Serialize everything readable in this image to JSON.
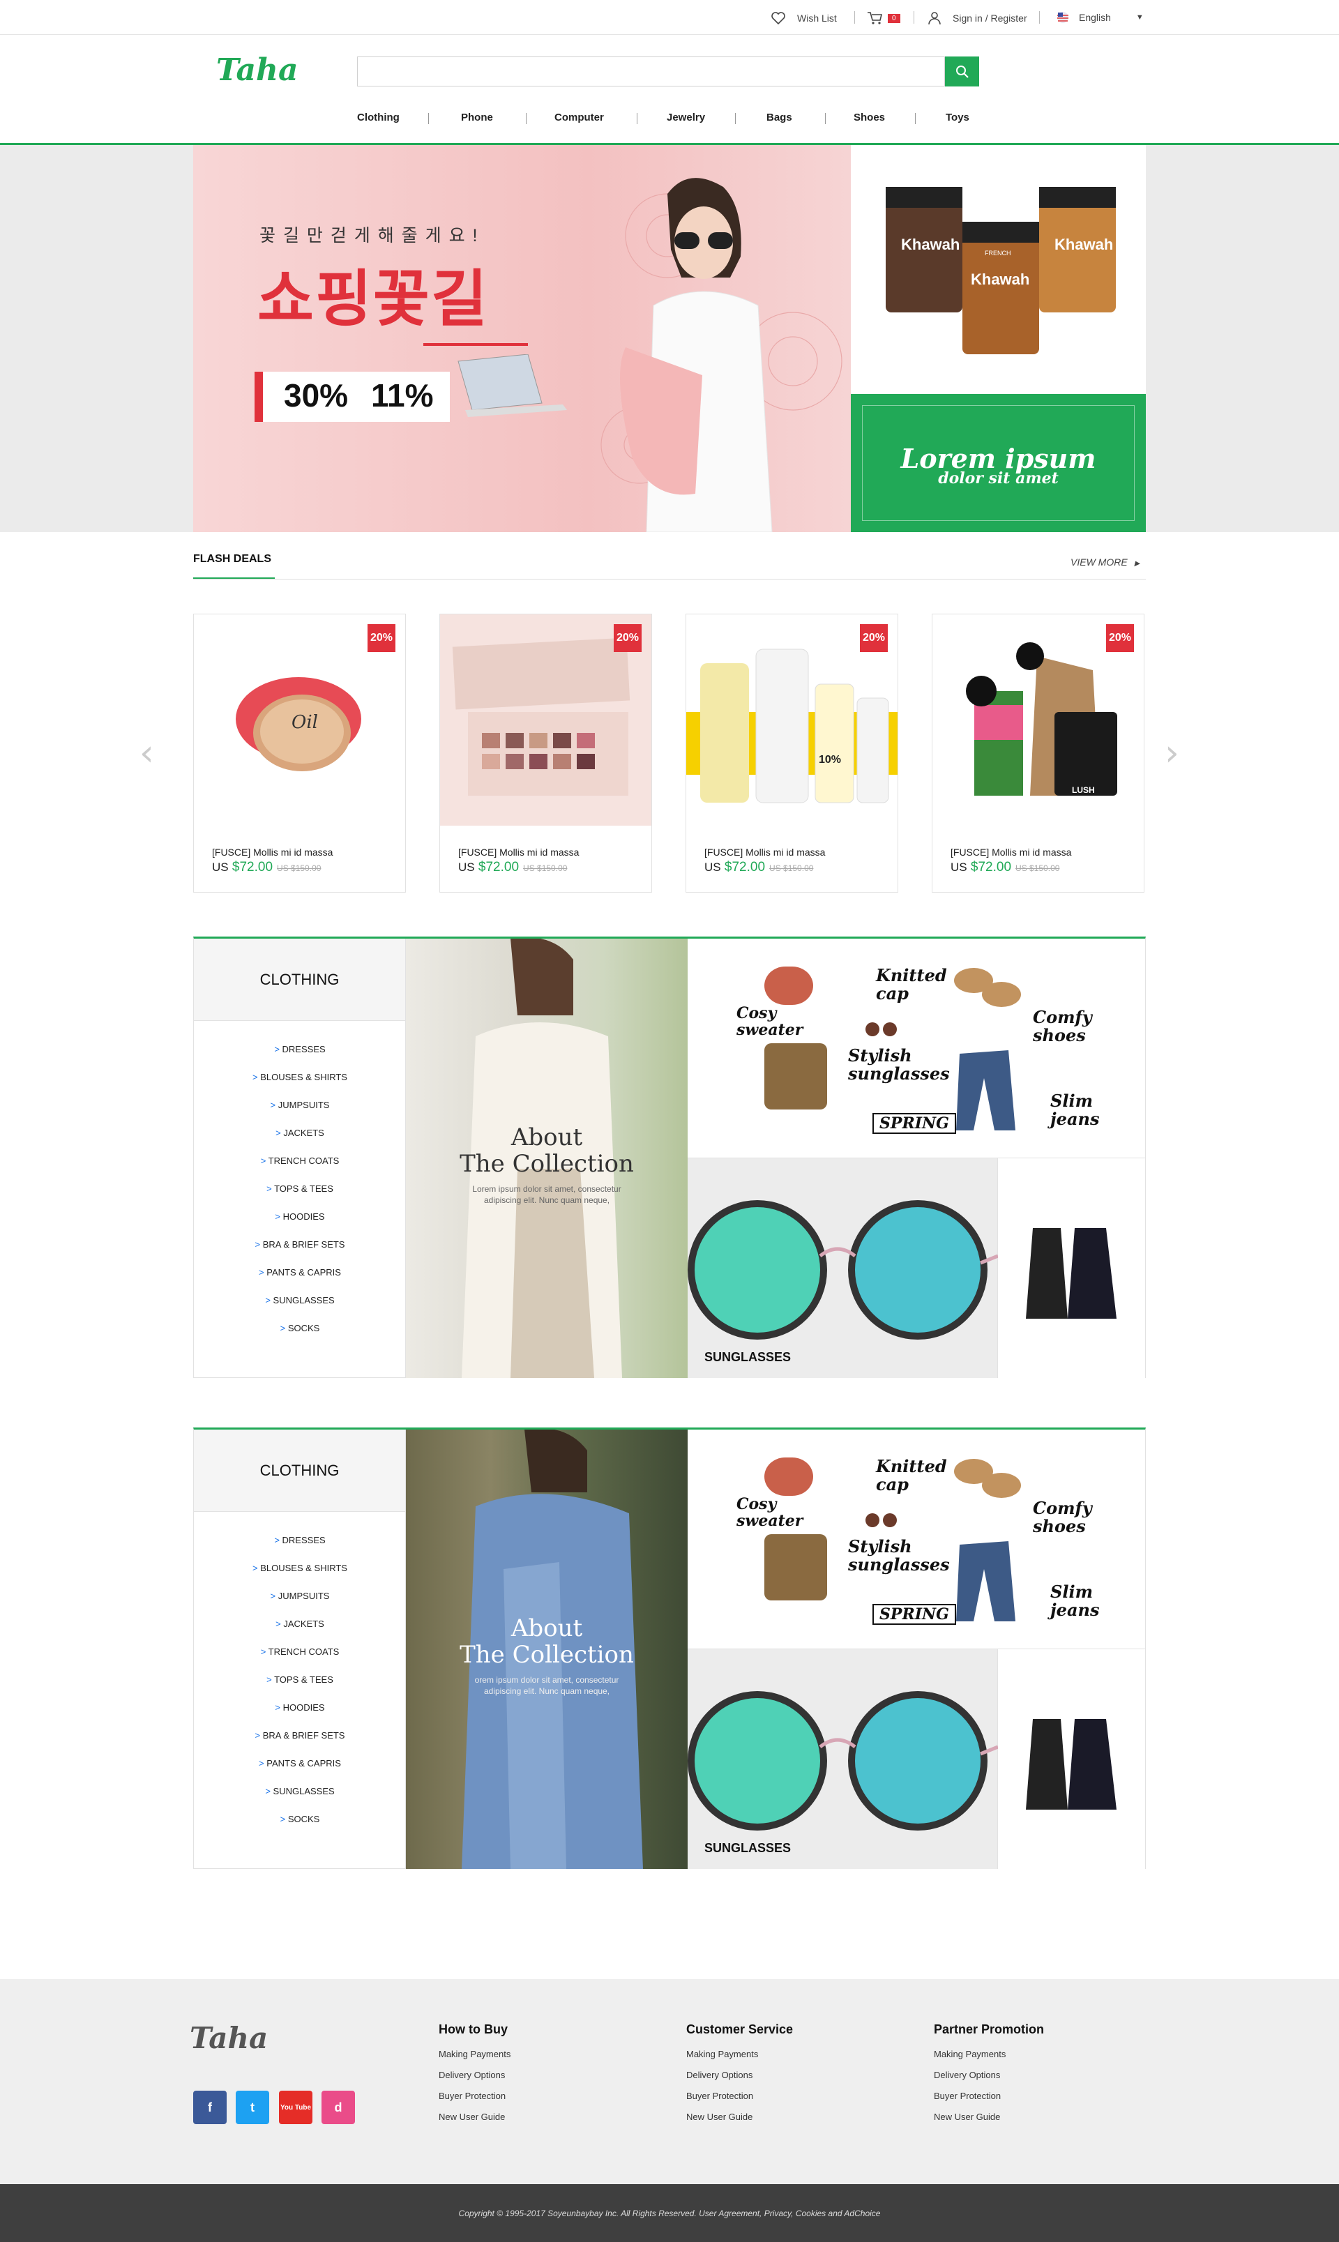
{
  "topbar": {
    "wishlist": "Wish List",
    "cart_count": "0",
    "signin": "Sign in / Register",
    "language": "English"
  },
  "header": {
    "logo": "Taha",
    "search": {
      "placeholder": ""
    },
    "nav": [
      "Clothing",
      "Phone",
      "Computer",
      "Jewelry",
      "Bags",
      "Shoes",
      "Toys"
    ]
  },
  "hero": {
    "tagline": "꽃 길 만 걷 게 해 줄 게 요 !",
    "headline": "쇼핑꽃길",
    "discount1": "30%",
    "discount2": "11%",
    "product_brand": "Khawah",
    "product_small": "FRENCH",
    "promo_title": "Lorem ipsum",
    "promo_sub": "dolor sit amet"
  },
  "flash": {
    "title": "FLASH DEALS",
    "view_more": "VIEW MORE"
  },
  "products": [
    {
      "badge": "20%",
      "name": "[FUSCE] Mollis mi id massa",
      "currency": "US",
      "price": "$72.00",
      "old": "US $150.00",
      "label": "Oil"
    },
    {
      "badge": "20%",
      "name": "[FUSCE] Mollis mi id massa",
      "currency": "US",
      "price": "$72.00",
      "old": "US $150.00",
      "label": ""
    },
    {
      "badge": "20%",
      "name": "[FUSCE] Mollis mi id massa",
      "currency": "US",
      "price": "$72.00",
      "old": "US $150.00",
      "label": "10%"
    },
    {
      "badge": "20%",
      "name": "[FUSCE] Mollis mi id massa",
      "currency": "US",
      "price": "$72.00",
      "old": "US $150.00",
      "label": "LUSH"
    }
  ],
  "sections": [
    {
      "category": "CLOTHING",
      "items": [
        "DRESSES",
        "BLOUSES & SHIRTS",
        "JUMPSUITS",
        "JACKETS",
        "TRENCH COATS",
        "TOPS & TEES",
        "HOODIES",
        "BRA & BRIEF SETS",
        "PANTS & CAPRIS",
        "SUNGLASSES",
        "SOCKS"
      ],
      "about": "About",
      "collection": "The Collection",
      "desc1": "Lorem ipsum dolor sit amet, consectetur",
      "desc2": "adipiscing elit. Nunc quam neque,",
      "sunglasses": "SUNGLASSES",
      "spring": [
        "Knitted cap",
        "Cosy sweater",
        "Comfy shoes",
        "Stylish sunglasses",
        "Slim jeans",
        "SPRING"
      ]
    },
    {
      "category": "CLOTHING",
      "items": [
        "DRESSES",
        "BLOUSES & SHIRTS",
        "JUMPSUITS",
        "JACKETS",
        "TRENCH COATS",
        "TOPS & TEES",
        "HOODIES",
        "BRA & BRIEF SETS",
        "PANTS & CAPRIS",
        "SUNGLASSES",
        "SOCKS"
      ],
      "about": "About",
      "collection": "The Collection",
      "desc1": "orem ipsum dolor sit amet, consectetur",
      "desc2": "adipiscing elit. Nunc quam neque,",
      "sunglasses": "SUNGLASSES",
      "spring": [
        "Knitted cap",
        "Cosy sweater",
        "Comfy shoes",
        "Stylish sunglasses",
        "Slim jeans",
        "SPRING"
      ]
    }
  ],
  "footer": {
    "logo": "Taha",
    "cols": [
      {
        "title": "How to Buy",
        "links": [
          "Making Payments",
          "Delivery Options",
          "Buyer Protection",
          "New User Guide"
        ]
      },
      {
        "title": "Customer Service",
        "links": [
          "Making Payments",
          "Delivery Options",
          "Buyer Protection",
          "New User Guide"
        ]
      },
      {
        "title": "Partner Promotion",
        "links": [
          "Making Payments",
          "Delivery Options",
          "Buyer Protection",
          "New User Guide"
        ]
      }
    ],
    "social": [
      "f",
      "t",
      "You Tube",
      "d"
    ],
    "copyright": "Copyright © 1995-2017 Soyeunbaybay Inc. All Rights Reserved. User Agreement, Privacy, Cookies and AdChoice"
  },
  "colors": {
    "accent": "#21a957",
    "badge": "#e0313b",
    "facebook": "#3b5998",
    "twitter": "#1da1f2",
    "youtube": "#e52d27",
    "dribbble": "#ea4c89"
  }
}
